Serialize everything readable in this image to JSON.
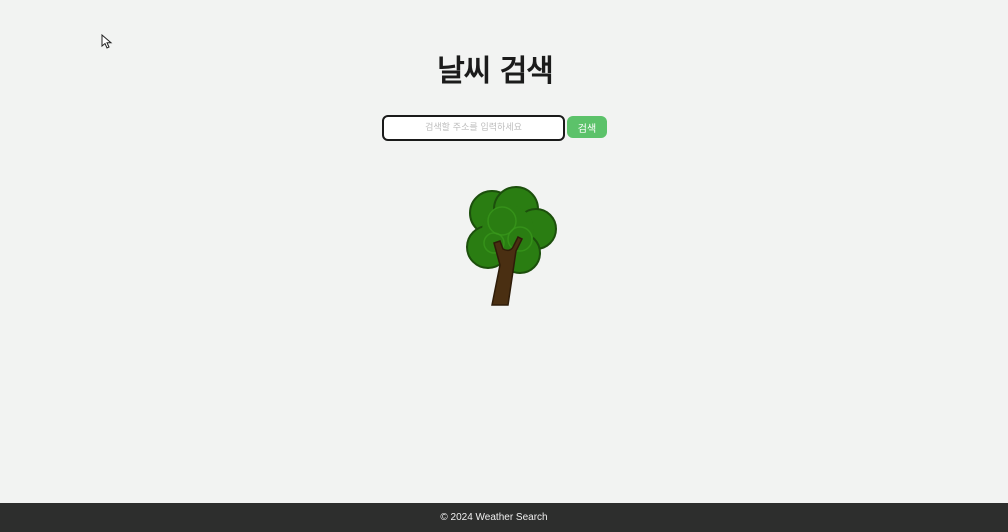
{
  "header": {
    "title": "날씨 검색"
  },
  "search": {
    "placeholder": "검색할 주소를 입력하세요",
    "value": "",
    "button_label": "검색",
    "button_color": "#5cc26a"
  },
  "illustration": {
    "icon": "tree-icon",
    "foliage_color": "#2a7d12",
    "trunk_color": "#4a2f12"
  },
  "footer": {
    "text": "© 2024 Weather Search"
  },
  "colors": {
    "background": "#f2f3f2",
    "footer_background": "#2d2e2d"
  }
}
